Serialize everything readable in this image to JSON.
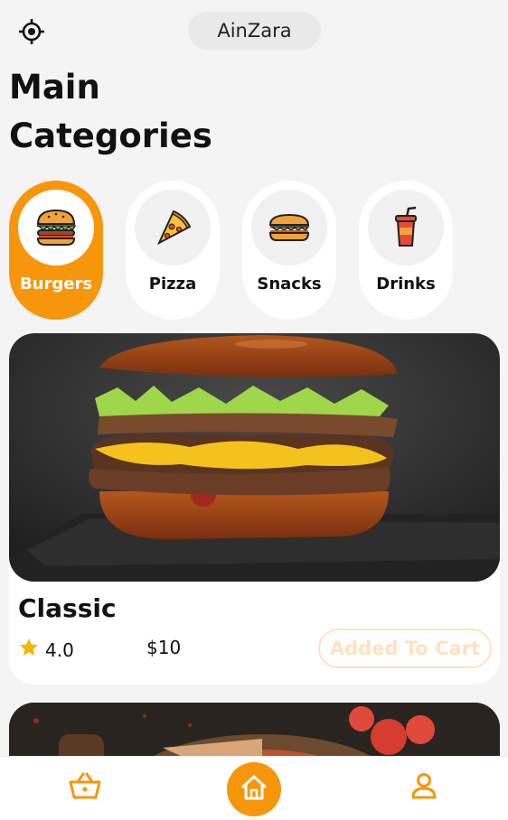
{
  "header": {
    "location_icon": "crosshair-icon",
    "city": "AinZara"
  },
  "title": {
    "line1": "Main",
    "line2": "Categories"
  },
  "categories": [
    {
      "label": "Burgers",
      "icon": "burger-icon",
      "active": true
    },
    {
      "label": "Pizza",
      "icon": "pizza-icon",
      "active": false
    },
    {
      "label": "Snacks",
      "icon": "sandwich-icon",
      "active": false
    },
    {
      "label": "Drinks",
      "icon": "soda-cup-icon",
      "active": false
    }
  ],
  "products": [
    {
      "name": "Classic",
      "rating": "4.0",
      "price": "$10",
      "cart_label": "Added To Cart",
      "image": "burger-photo"
    },
    {
      "image": "pizza-photo"
    }
  ],
  "bottom_nav": {
    "items": [
      "basket-icon",
      "home-icon",
      "user-icon"
    ],
    "active": "home-icon"
  },
  "colors": {
    "accent": "#f7960b",
    "background": "#f4f4f4",
    "card": "#ffffff",
    "star": "#f5b400",
    "cart_border": "#fde3bf"
  }
}
